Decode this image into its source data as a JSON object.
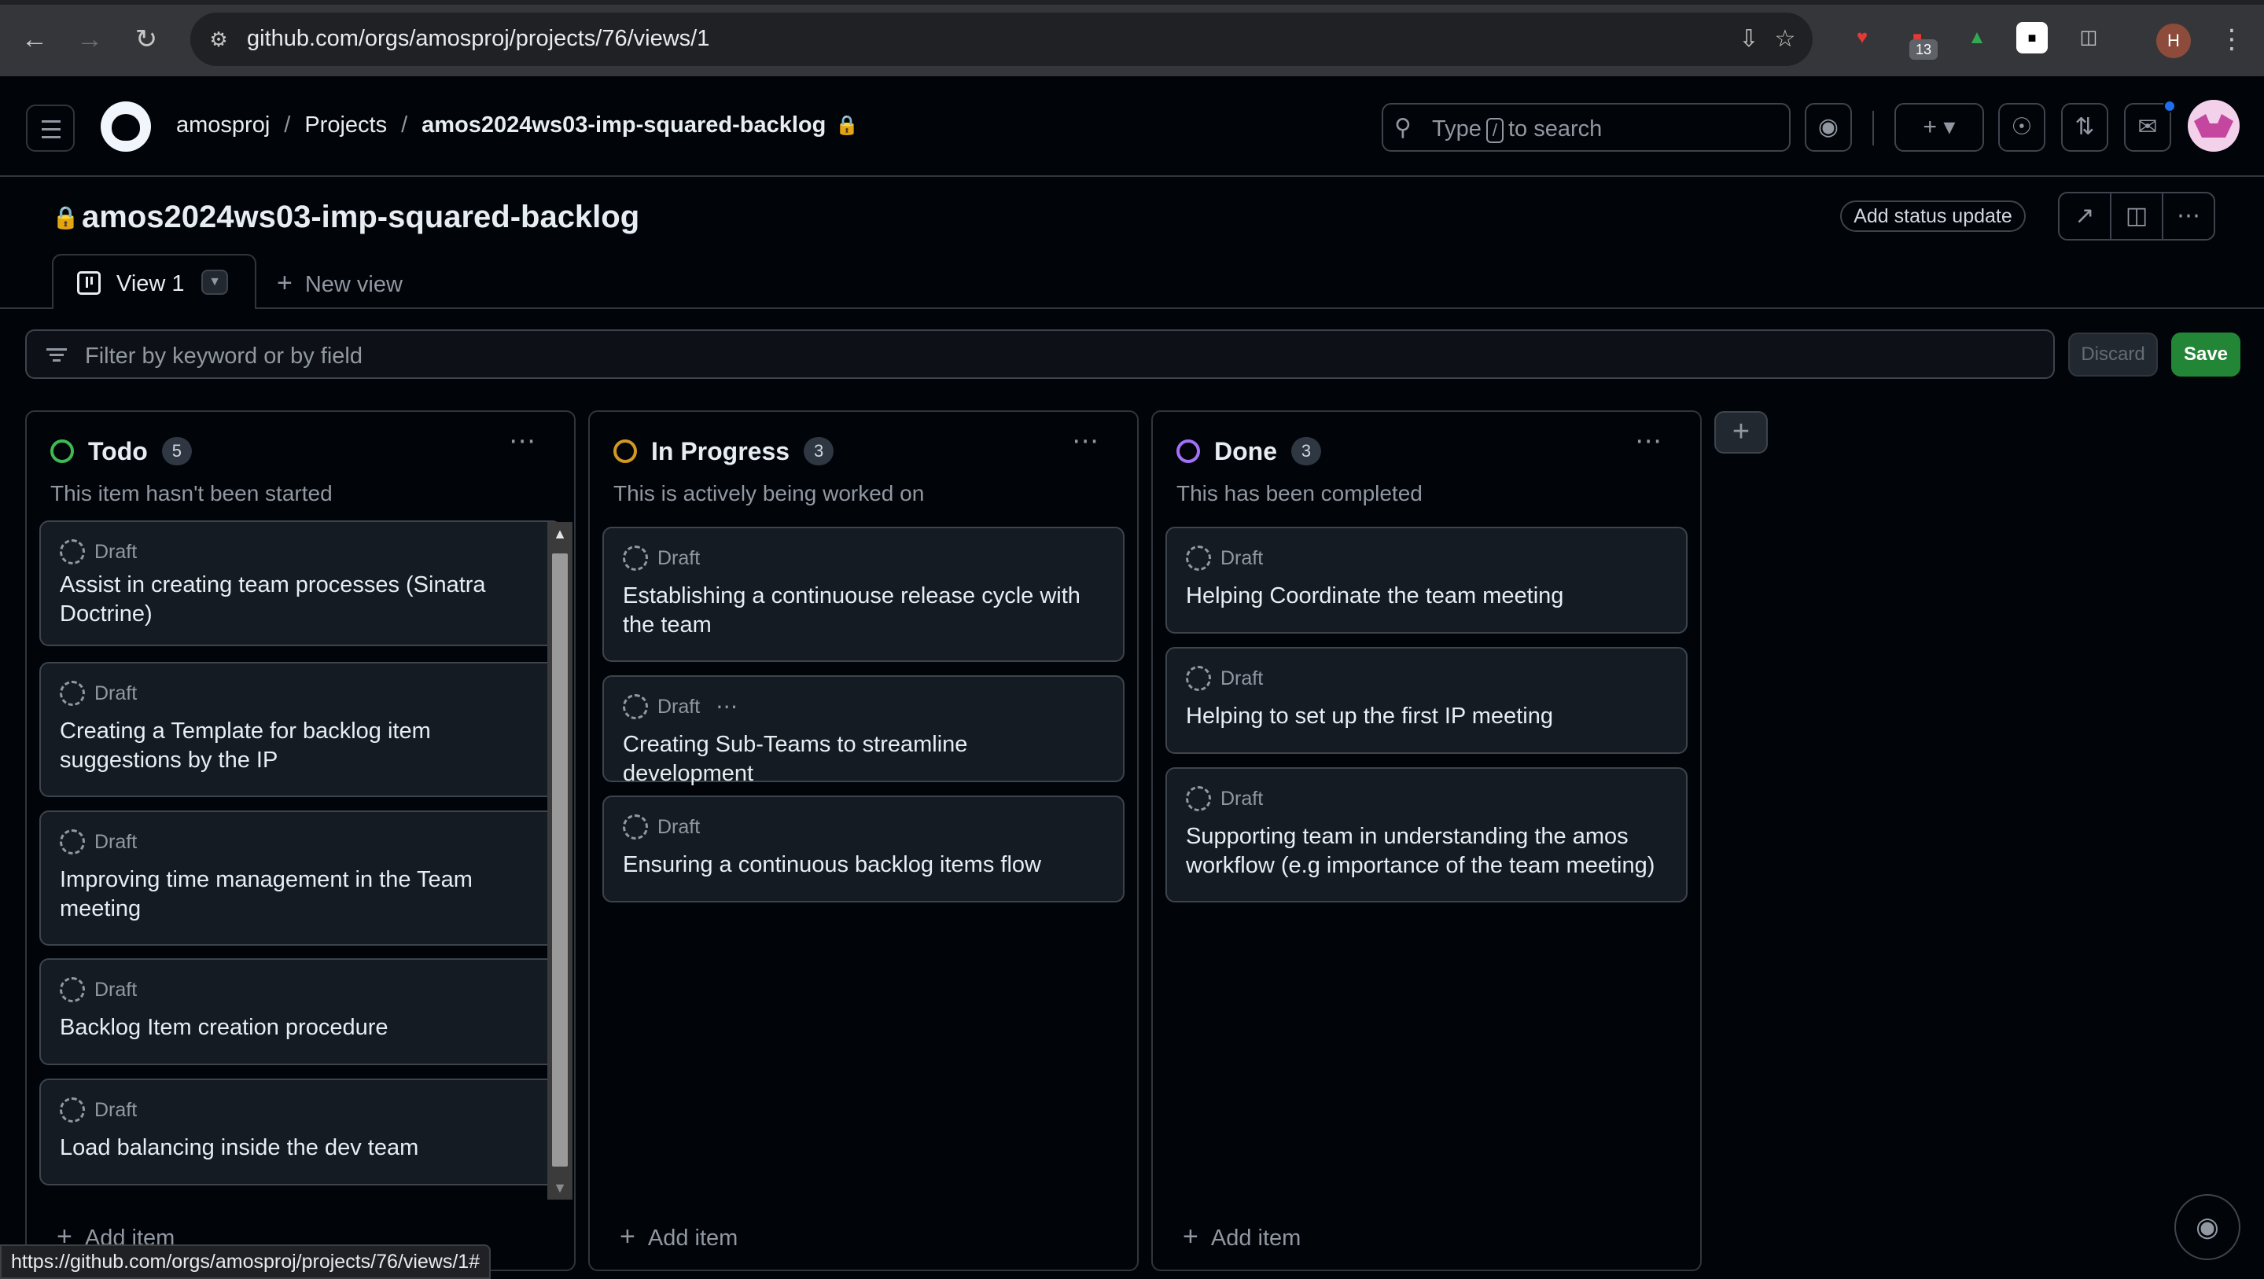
{
  "browser": {
    "url": "github.com/orgs/amosproj/projects/76/views/1",
    "extension_badge": "13",
    "profile_initial": "H",
    "status_url": "https://github.com/orgs/amosproj/projects/76/views/1#"
  },
  "header": {
    "breadcrumbs": [
      "amosproj",
      "Projects",
      "amos2024ws03-imp-squared-backlog"
    ],
    "search_prefix": "Type",
    "search_key": "/",
    "search_suffix": "to search",
    "icons": [
      "hamburger-icon",
      "github-logo-icon",
      "copilot-icon",
      "plus-icon",
      "issues-icon",
      "pull-requests-icon",
      "inbox-icon",
      "avatar"
    ]
  },
  "project": {
    "title": "amos2024ws03-imp-squared-backlog",
    "status_update_label": "Add status update",
    "tabs": [
      {
        "label": "View 1"
      }
    ],
    "new_view_label": "New view",
    "filter_placeholder": "Filter by keyword or by field",
    "discard_label": "Discard",
    "save_label": "Save"
  },
  "columns": [
    {
      "name": "Todo",
      "count": "5",
      "description": "This item hasn't been started",
      "color": "#3fb950",
      "add_item_label": "Add item",
      "cards": [
        {
          "tag": "Draft",
          "title": "Assist in creating team processes (Sinatra Doctrine)"
        },
        {
          "tag": "Draft",
          "title": "Creating a Template for backlog item suggestions by the IP"
        },
        {
          "tag": "Draft",
          "title": "Improving time management in the Team meeting"
        },
        {
          "tag": "Draft",
          "title": "Backlog Item creation procedure"
        },
        {
          "tag": "Draft",
          "title": "Load balancing inside the dev team"
        }
      ]
    },
    {
      "name": "In Progress",
      "count": "3",
      "description": "This is actively being worked on",
      "color": "#d29922",
      "add_item_label": "Add item",
      "cards": [
        {
          "tag": "Draft",
          "title": "Establishing a continuouse release cycle with the team"
        },
        {
          "tag": "Draft",
          "title": "Creating Sub-Teams to streamline development"
        },
        {
          "tag": "Draft",
          "title": "Ensuring a continuous backlog items flow"
        }
      ]
    },
    {
      "name": "Done",
      "count": "3",
      "description": "This has been completed",
      "color": "#a371f7",
      "add_item_label": "Add item",
      "cards": [
        {
          "tag": "Draft",
          "title": "Helping Coordinate the team meeting"
        },
        {
          "tag": "Draft",
          "title": "Helping to set up the first IP meeting"
        },
        {
          "tag": "Draft",
          "title": "Supporting team in understanding the amos workflow (e.g importance of the team meeting)"
        }
      ]
    }
  ]
}
